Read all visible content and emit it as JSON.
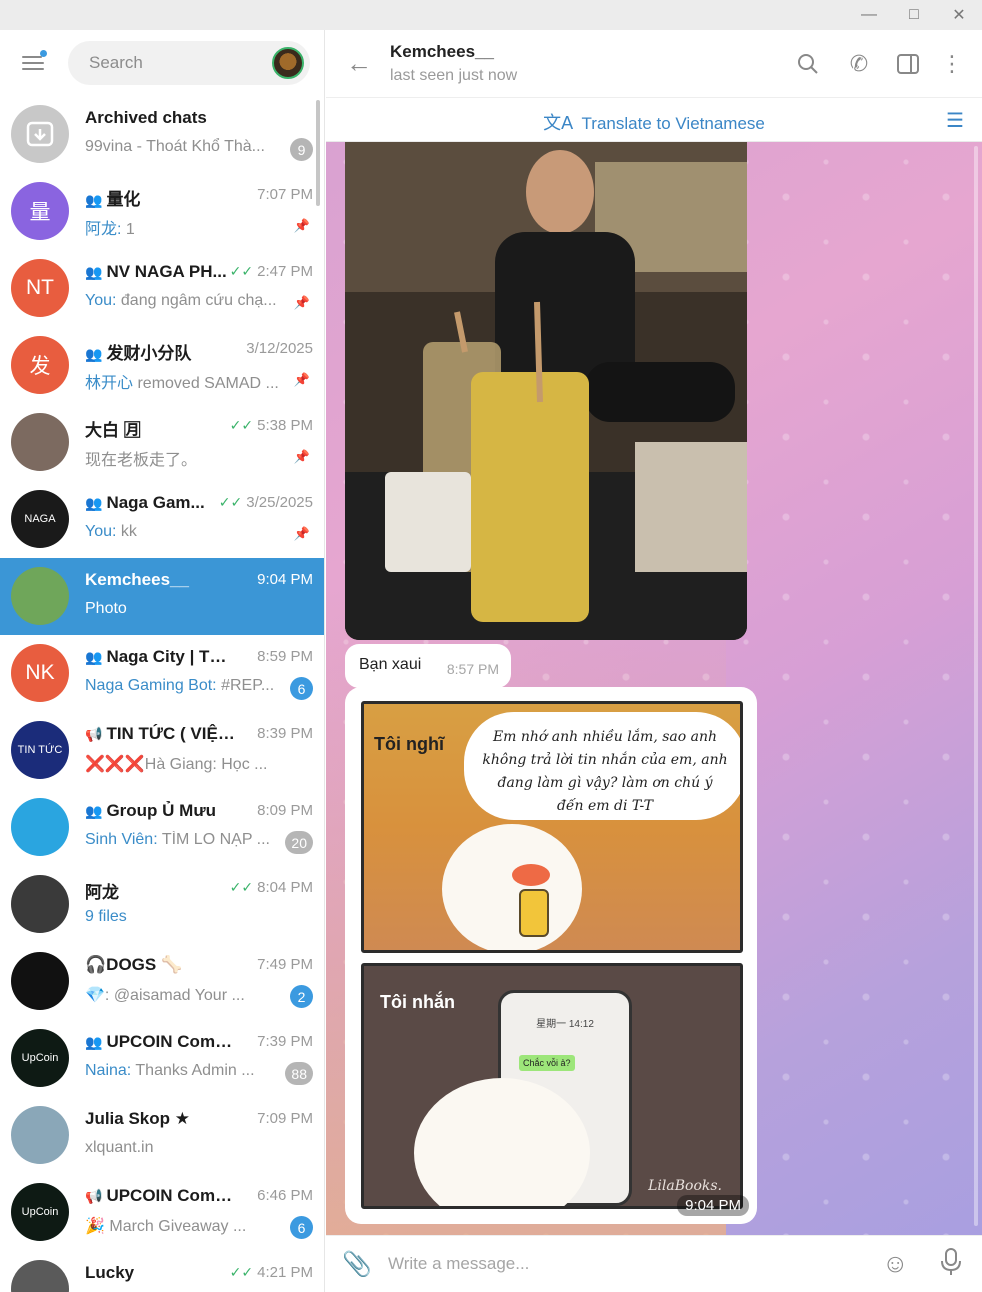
{
  "sidebar": {
    "search_placeholder": "Search",
    "chats": [
      {
        "name": "Archived chats",
        "preview": "99vina - Thoát Khổ Thà...",
        "badge": "9",
        "avatar": "",
        "avatar_color": "#c8c8c8"
      },
      {
        "name": "量化",
        "time": "7:07 PM",
        "sender": "阿龙:",
        "preview": "1",
        "avatar": "量",
        "avatar_color": "#8a64e0",
        "group": true,
        "pinned": true
      },
      {
        "name": "NV NAGA PH...",
        "time": "2:47 PM",
        "sender": "You:",
        "preview": "đang ngâm cứu chạ...",
        "avatar": "NT",
        "avatar_color": "#e85d3f",
        "group": true,
        "pinned": true,
        "read": true
      },
      {
        "name": "发财小分队",
        "time": "3/12/2025",
        "sender": "林开心",
        "preview": "removed SAMAD ...",
        "avatar": "发",
        "avatar_color": "#e85d3f",
        "group": true,
        "pinned": true
      },
      {
        "name": "大白 🈷",
        "time": "5:38 PM",
        "preview": "现在老板走了。",
        "avatar": "",
        "avatar_color": "#7c6a60",
        "pinned": true,
        "read": true
      },
      {
        "name": "Naga Gam...",
        "time": "3/25/2025",
        "sender": "You:",
        "preview": "kk",
        "avatar": "NAGA",
        "avatar_color": "#1a1a1a",
        "group": true,
        "pinned": true,
        "read": true
      },
      {
        "name": "Kemchees__",
        "time": "9:04 PM",
        "preview": "Photo",
        "avatar": "",
        "avatar_color": "#6fa65a",
        "active": true
      },
      {
        "name": "Naga City | Thố...",
        "time": "8:59 PM",
        "sender": "Naga Gaming Bot:",
        "preview": "#REP...",
        "badge": "6",
        "badge_blue": true,
        "avatar": "NK",
        "avatar_color": "#e85d3f",
        "group": true
      },
      {
        "name": "TIN TỨC ( VIỆT - ...",
        "time": "8:39 PM",
        "preview": "❌❌❌Hà Giang: Học ...",
        "avatar": "TIN TỨC",
        "avatar_color": "#1b2c7a",
        "channel": true
      },
      {
        "name": "Group Ủ Mưu",
        "time": "8:09 PM",
        "sender": "Sinh Viên:",
        "preview": "TÌM LO NẠP ...",
        "badge": "20",
        "avatar": "",
        "avatar_color": "#2aa5e0",
        "group": true
      },
      {
        "name": "阿龙",
        "time": "8:04 PM",
        "preview": "9 files",
        "preview_blue": true,
        "avatar": "",
        "avatar_color": "#3a3a3a",
        "read": true
      },
      {
        "name": "🎧DOGS 🦴",
        "time": "7:49 PM",
        "preview": "💎: @aisamad Your ...",
        "badge": "2",
        "badge_blue": true,
        "avatar": "",
        "avatar_color": "#111111"
      },
      {
        "name": "UPCOIN Comm...",
        "time": "7:39 PM",
        "sender": "Naina:",
        "preview": "Thanks Admin ...",
        "badge": "88",
        "avatar": "UpCoin",
        "avatar_color": "#0e1a14",
        "group": true
      },
      {
        "name": "Julia Skop ★",
        "time": "7:09 PM",
        "preview": "xlquant.in",
        "avatar": "",
        "avatar_color": "#8aa7b8"
      },
      {
        "name": "UPCOIN Comm...",
        "time": "6:46 PM",
        "preview": "🎉 March Giveaway ...",
        "badge": "6",
        "badge_blue": true,
        "avatar": "UpCoin",
        "avatar_color": "#0e1a14",
        "channel": true
      },
      {
        "name": "Lucky",
        "time": "4:21 PM",
        "preview": "",
        "avatar": "",
        "avatar_color": "#5a5a5a",
        "read": true
      }
    ]
  },
  "header": {
    "name": "Kemchees__",
    "status": "last seen just now"
  },
  "translate": {
    "label": "Translate to Vietnamese"
  },
  "messages": {
    "text_message": {
      "text": "Bạn xaui",
      "time": "8:57 PM"
    },
    "sticker": {
      "caption_top": "Tôi nghĩ",
      "thought": "Em nhớ anh nhiều lắm, sao anh không trả lời tin nhắn của em, anh đang làm gì vậy? làm ơn chú ý đến em di T-T",
      "caption_bottom": "Tôi nhắn",
      "phone_time": "星期一 14:12",
      "bubble_text": "Chắc vỗi ả?",
      "watermark": "LilaBooks.",
      "time": "9:04 PM"
    }
  },
  "composer": {
    "placeholder": "Write a message..."
  }
}
